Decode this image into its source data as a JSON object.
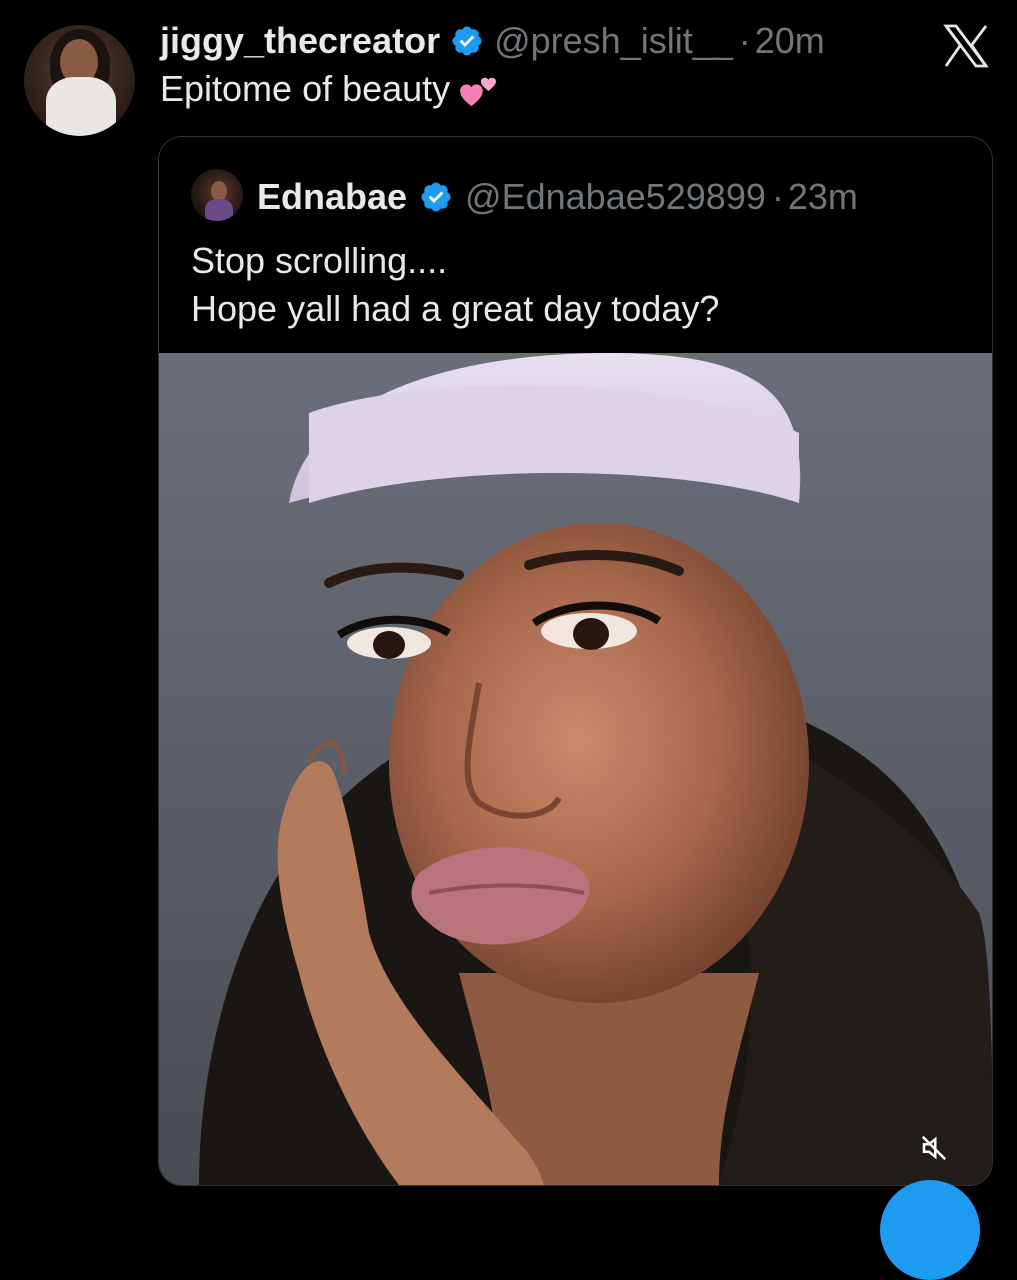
{
  "tweet": {
    "display_name": "jiggy_thecreator",
    "handle": "@presh_islit__",
    "separator": "·",
    "time": "20m",
    "text": "Epitome of beauty",
    "emoji": "two-hearts-emoji"
  },
  "quoted_tweet": {
    "display_name": "Ednabae",
    "handle": "@Ednabae529899",
    "separator": "·",
    "time": "23m",
    "text_lines": [
      "Stop scrolling....",
      "Hope yall had a great day today?"
    ],
    "media": {
      "type": "video",
      "muted": true
    }
  },
  "icons": {
    "verified": "verified-badge-icon",
    "logo": "x-logo-icon",
    "mute": "volume-muted-icon"
  },
  "colors": {
    "background": "#000000",
    "text_primary": "#e7e9ea",
    "text_secondary": "#71767b",
    "verified_blue": "#1d9bf0",
    "card_border": "#2f3336",
    "emoji_pink": "#f47fb4"
  }
}
